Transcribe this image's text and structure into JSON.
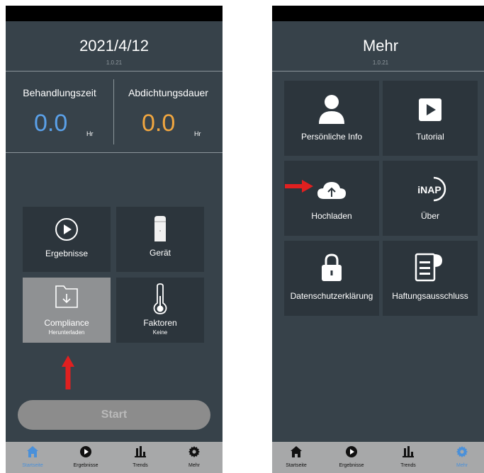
{
  "left_screen": {
    "header": {
      "date": "2021/4/12",
      "version": "1.0.21"
    },
    "metrics": {
      "treatment": {
        "label": "Behandlungszeit",
        "value": "0.0",
        "unit": "Hr"
      },
      "seal": {
        "label": "Abdichtungsdauer",
        "value": "0.0",
        "unit": "Hr"
      }
    },
    "tiles": {
      "results": {
        "label": "Ergebnisse"
      },
      "device": {
        "label": "Gerät"
      },
      "compliance": {
        "label": "Compliance",
        "sub": "Herunterladen"
      },
      "factors": {
        "label": "Faktoren",
        "sub": "Keine"
      }
    },
    "start_button": "Start",
    "tabs": [
      "Startseite",
      "Ergebnisse",
      "Trends",
      "Mehr"
    ]
  },
  "right_screen": {
    "header": {
      "title": "Mehr",
      "version": "1.0.21"
    },
    "tiles": {
      "personal": {
        "label": "Persönliche Info"
      },
      "tutorial": {
        "label": "Tutorial"
      },
      "upload": {
        "label": "Hochladen"
      },
      "about": {
        "label": "Über",
        "logo": "iNAP"
      },
      "privacy": {
        "label": "Datenschutzerklärung"
      },
      "disclaimer": {
        "label": "Haftungsausschluss"
      }
    },
    "tabs": [
      "Startseite",
      "Ergebnisse",
      "Trends",
      "Mehr"
    ]
  },
  "colors": {
    "background": "#37424a",
    "tile": "#2c353c",
    "tile_selected": "#8f9193",
    "treatment_value": "#5aa0e8",
    "seal_value": "#f0a640",
    "tab_active": "#4a90d9",
    "arrow": "#e02020"
  },
  "icons": {
    "results": "play-circle-icon",
    "device": "device-icon",
    "compliance": "download-folder-icon",
    "factors": "thermometer-icon",
    "personal": "person-icon",
    "tutorial": "play-square-icon",
    "upload": "cloud-upload-icon",
    "about": "inap-logo",
    "privacy": "lock-icon",
    "disclaimer": "scroll-icon",
    "tabs": [
      "home-icon",
      "play-circle-icon",
      "bar-chart-icon",
      "gear-icon"
    ]
  },
  "active_tab": {
    "left": "Startseite",
    "right": "Mehr"
  }
}
